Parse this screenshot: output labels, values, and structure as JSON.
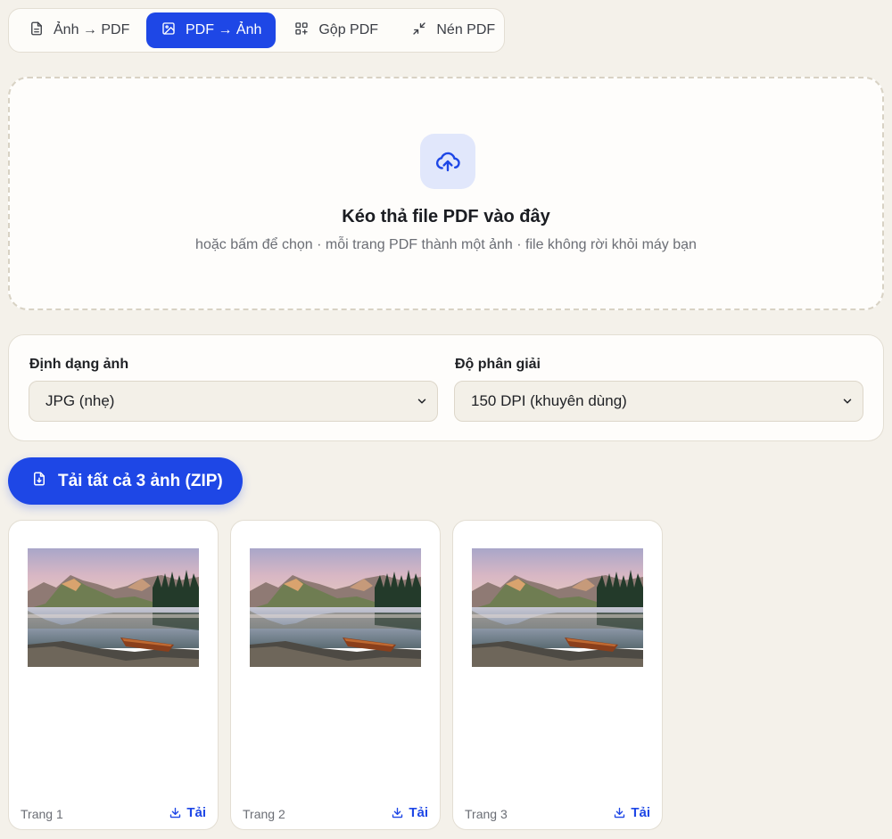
{
  "tabs": [
    {
      "label": "Ảnh → PDF",
      "icon": "document-icon",
      "active": false
    },
    {
      "label": "PDF → Ảnh",
      "icon": "image-icon",
      "active": true
    },
    {
      "label": "Gộp PDF",
      "icon": "merge-icon",
      "active": false
    },
    {
      "label": "Nén PDF",
      "icon": "compress-icon",
      "active": false
    }
  ],
  "dropzone": {
    "title": "Kéo thả file PDF vào đây",
    "subtitle": "hoặc bấm để chọn · mỗi trang PDF thành một ảnh · file không rời khỏi máy bạn",
    "icon": "upload-cloud-icon"
  },
  "options": {
    "format_label": "Định dạng ảnh",
    "format_value": "JPG (nhẹ)",
    "dpi_label": "Độ phân giải",
    "dpi_value": "150 DPI (khuyên dùng)"
  },
  "zip_button": {
    "label": "Tải tất cả 3 ảnh (ZIP)",
    "icon": "file-download-icon"
  },
  "pages": [
    {
      "label": "Trang 1",
      "download_label": "Tải"
    },
    {
      "label": "Trang 2",
      "download_label": "Tải"
    },
    {
      "label": "Trang 3",
      "download_label": "Tải"
    }
  ],
  "colors": {
    "accent": "#1e47e6",
    "background": "#f4f1ea",
    "panel": "#fefdfb"
  }
}
